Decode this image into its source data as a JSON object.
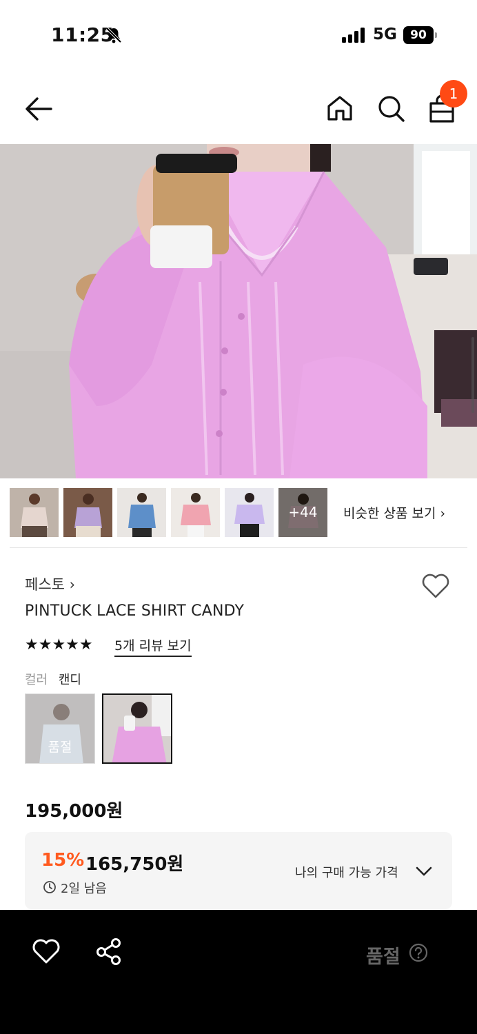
{
  "status_bar": {
    "time": "11:25",
    "network": "5G",
    "battery": "90"
  },
  "header": {
    "cart_count": "1"
  },
  "thumbnails": {
    "more_label": "+44",
    "similar_label": "비슷한 상품 보기 ›"
  },
  "product": {
    "brand": "페스토 ›",
    "name": "PINTUCK LACE SHIRT CANDY",
    "rating_stars": "★★★★★",
    "reviews_label": "5개 리뷰 보기",
    "color_key": "컬러",
    "color_value": "캔디",
    "soldout_swatch_label": "품절",
    "original_price": "195,000원",
    "discount": "15%",
    "sale_price": "165,750원",
    "time_left": "2일 남음",
    "my_price_label": "나의 구매 가능 가격"
  },
  "bottom_bar": {
    "soldout_label": "품절"
  },
  "colors": {
    "accent": "#ff4a14",
    "discount": "#ff5a1f",
    "shirt": "#e9a6e6"
  }
}
